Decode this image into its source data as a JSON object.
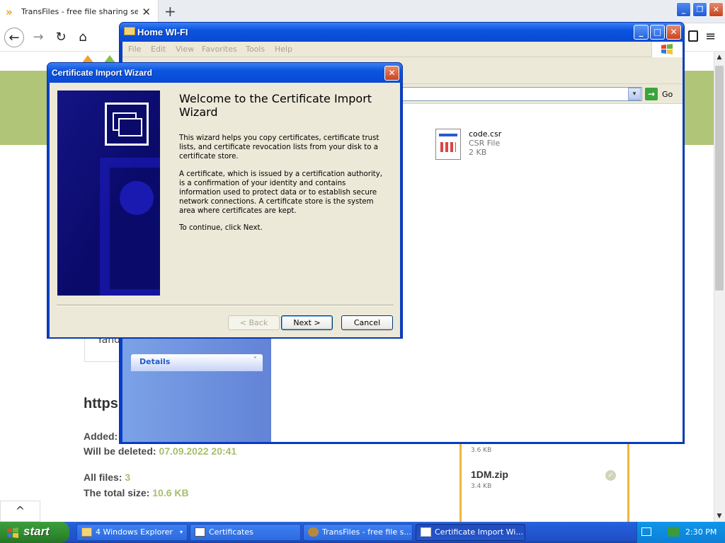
{
  "browser": {
    "tab_title": "TransFiles - free file sharing service",
    "tab_favicon": "»",
    "tab_close": "✕",
    "new_tab": "+",
    "nav_back": "←",
    "nav_forward": "→",
    "nav_reload": "↻",
    "nav_home": "⌂",
    "nav_menu": "≡",
    "win_min": "_",
    "win_restore": "❐",
    "win_close": "✕",
    "scroll_up": "▲",
    "scroll_down": "▼"
  },
  "page": {
    "search_fragment": "Yand",
    "link_fragment": "https",
    "added_label": "Added:",
    "will_be_deleted_label": "Will be deleted:",
    "will_be_deleted_value": "07.09.2022 20:41",
    "all_files_label": "All files:",
    "all_files_value": "3",
    "total_size_label": "The total size:",
    "total_size_value": "10.6 KB",
    "scroll_top_icon": "^",
    "files": [
      {
        "name": "",
        "size": "3.6 KB"
      },
      {
        "name": "1DM.zip",
        "size": "3.4 KB"
      }
    ],
    "check_icon": "✓"
  },
  "explorer": {
    "title": "Home WI-FI",
    "menu": [
      "File",
      "Edit",
      "View",
      "Favorites",
      "Tools",
      "Help"
    ],
    "go_label": "Go",
    "go_icon": "→",
    "dropdown_icon": "▾",
    "details_label": "Details",
    "details_chevron": "˅",
    "min": "_",
    "max": "□",
    "close": "✕",
    "file": {
      "name": "code.csr",
      "type": "CSR File",
      "size": "2 KB"
    }
  },
  "wizard": {
    "title": "Certificate Import Wizard",
    "close": "✕",
    "heading": "Welcome to the Certificate Import Wizard",
    "para1": "This wizard helps you copy certificates, certificate trust lists, and certificate revocation lists from your disk to a certificate store.",
    "para2": "A certificate, which is issued by a certification authority, is a confirmation of your identity and contains information used to protect data or to establish secure network connections. A certificate store is the system area where certificates are kept.",
    "para3": "To continue, click Next.",
    "back_label": "< Back",
    "next_label": "Next >",
    "cancel_label": "Cancel"
  },
  "taskbar": {
    "start_label": "start",
    "items": [
      {
        "label": "4 Windows Explorer",
        "arrow": "▾"
      },
      {
        "label": "Certificates"
      },
      {
        "label": "TransFiles - free file s..."
      },
      {
        "label": "Certificate Import Wi..."
      }
    ],
    "clock": "2:30 PM"
  },
  "colors": {
    "xp_title_blue": "#0b54df",
    "site_green": "#b1c579",
    "accent_orange": "#f1b43a",
    "value_green": "#a9bd6d"
  }
}
